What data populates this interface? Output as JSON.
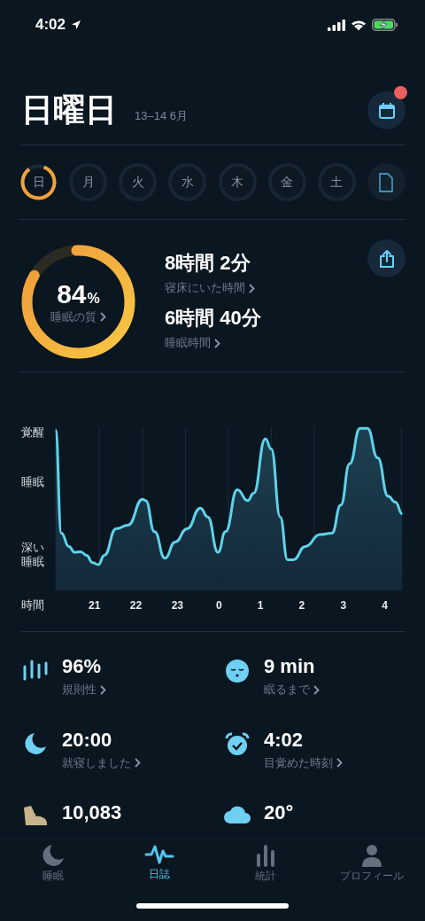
{
  "status_bar": {
    "time": "4:02"
  },
  "header": {
    "title": "日曜日",
    "date_range": "13–14 6月",
    "notification": true
  },
  "days": [
    {
      "label": "日",
      "selected": true
    },
    {
      "label": "月",
      "selected": false
    },
    {
      "label": "火",
      "selected": false
    },
    {
      "label": "水",
      "selected": false
    },
    {
      "label": "木",
      "selected": false
    },
    {
      "label": "金",
      "selected": false
    },
    {
      "label": "土",
      "selected": false
    }
  ],
  "summary": {
    "quality": {
      "value": "84",
      "unit": "%",
      "label": "睡眠の質",
      "level": 0.84
    },
    "metrics": [
      {
        "value": "8時間 2分",
        "label": "寝床にいた時間"
      },
      {
        "value": "6時間 40分",
        "label": "睡眠時間"
      }
    ]
  },
  "chart": {
    "y_labels": [
      "覚醒",
      "睡眠",
      "深い睡眠"
    ],
    "x_title": "時間",
    "x_labels": [
      "21",
      "22",
      "23",
      "0",
      "1",
      "2",
      "3",
      "4"
    ]
  },
  "stats": [
    {
      "value": "96%",
      "label": "規則性"
    },
    {
      "value": "9 min",
      "label": "眠るまで"
    },
    {
      "value": "20:00",
      "label": "就寝しました"
    },
    {
      "value": "4:02",
      "label": "目覚めた時刻"
    },
    {
      "value": "10,083"
    },
    {
      "value": "20°"
    }
  ],
  "tabs": [
    {
      "label": "睡眠",
      "selected": false
    },
    {
      "label": "日誌",
      "selected": true
    },
    {
      "label": "統計",
      "selected": false
    },
    {
      "label": "プロフィール",
      "selected": false
    }
  ]
}
